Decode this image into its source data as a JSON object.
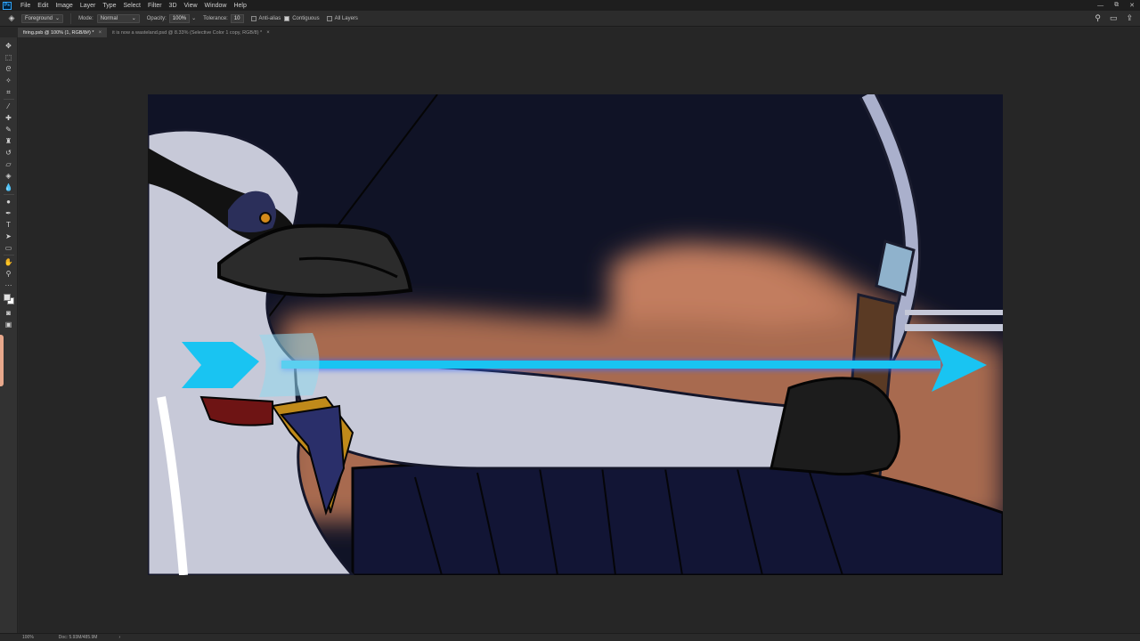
{
  "app": {
    "logo_text": "Ps",
    "menu": [
      "File",
      "Edit",
      "Image",
      "Layer",
      "Type",
      "Select",
      "Filter",
      "3D",
      "View",
      "Window",
      "Help"
    ]
  },
  "window_controls": {
    "minimize": "—",
    "restore": "⧉",
    "close": "✕"
  },
  "options_bar": {
    "fill_source": "Foreground",
    "mode_label": "Mode:",
    "mode_value": "Normal",
    "opacity_label": "Opacity:",
    "opacity_value": "100%",
    "tolerance_label": "Tolerance:",
    "tolerance_value": "10",
    "anti_alias_label": "Anti-alias",
    "anti_alias_checked": false,
    "contiguous_label": "Contiguous",
    "contiguous_checked": true,
    "all_layers_label": "All Layers",
    "all_layers_checked": false
  },
  "tabs": [
    {
      "label": "firing.psb @ 100% (1, RGB/8#) *",
      "active": true
    },
    {
      "label": "it is now a wasteland.psd @ 8.33% (Selective Color 1 copy, RGB/8) *",
      "active": false
    }
  ],
  "tab_close_glyph": "×",
  "toolbar": {
    "tools": [
      {
        "name": "move-tool-icon",
        "glyph": "✥"
      },
      {
        "name": "marquee-tool-icon",
        "glyph": "⬚"
      },
      {
        "name": "lasso-tool-icon",
        "glyph": "ᘓ"
      },
      {
        "name": "magic-wand-tool-icon",
        "glyph": "✧"
      },
      {
        "name": "crop-tool-icon",
        "glyph": "⌗"
      },
      {
        "name": "eyedropper-tool-icon",
        "glyph": "⁄"
      },
      {
        "name": "healing-brush-tool-icon",
        "glyph": "✚"
      },
      {
        "name": "brush-tool-icon",
        "glyph": "✎"
      },
      {
        "name": "clone-stamp-tool-icon",
        "glyph": "♜"
      },
      {
        "name": "history-brush-tool-icon",
        "glyph": "↺"
      },
      {
        "name": "eraser-tool-icon",
        "glyph": "▱"
      },
      {
        "name": "paint-bucket-tool-icon",
        "glyph": "◈"
      },
      {
        "name": "blur-tool-icon",
        "glyph": "💧"
      },
      {
        "name": "dodge-tool-icon",
        "glyph": "●"
      },
      {
        "name": "pen-tool-icon",
        "glyph": "✒"
      },
      {
        "name": "type-tool-icon",
        "glyph": "T"
      },
      {
        "name": "path-selection-tool-icon",
        "glyph": "➤"
      },
      {
        "name": "shape-tool-icon",
        "glyph": "▭"
      },
      {
        "name": "hand-tool-icon",
        "glyph": "✋"
      },
      {
        "name": "zoom-tool-icon",
        "glyph": "⚲"
      },
      {
        "name": "more-tools-icon",
        "glyph": "···"
      }
    ],
    "bottom_tools": [
      {
        "name": "quick-mask-icon",
        "glyph": "◙"
      },
      {
        "name": "screen-mode-icon",
        "glyph": "▣"
      }
    ]
  },
  "status_bar": {
    "zoom": "100%",
    "doc_info": "Doc: 5.93M/485.9M",
    "arrow": "›"
  },
  "canvas_colors": {
    "sky": "#101326",
    "rock": "#b06e52",
    "arrow": "#19c4f2",
    "bow": "#aab0cc",
    "feathers": "#c7c9d8",
    "coat": "#121535",
    "beak": "#2b2b2b",
    "gold": "#c08a1a"
  }
}
